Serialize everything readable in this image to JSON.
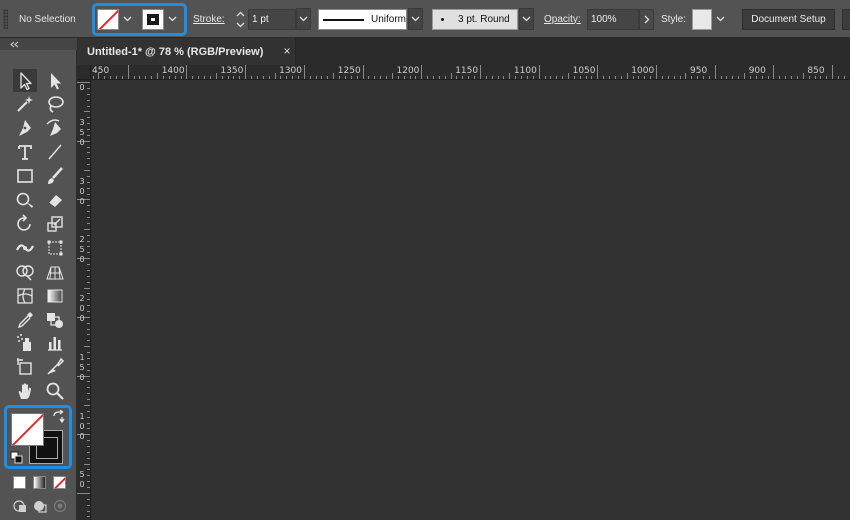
{
  "control_bar": {
    "selection_label": "No Selection",
    "fill_swatch": "none",
    "stroke_swatch": "black",
    "stroke_label": "Stroke:",
    "stroke_weight": "1 pt",
    "variable_width_profile": "Uniform",
    "brush_definition": "3 pt. Round",
    "opacity_label": "Opacity:",
    "opacity_value": "100%",
    "style_label": "Style:",
    "document_setup_label": "Document Setup"
  },
  "document": {
    "tab_title": "Untitled-1* @ 78 % (RGB/Preview)",
    "close_glyph": "×"
  },
  "rulers": {
    "horizontal_labels": [
      "450",
      "1400",
      "1350",
      "1300",
      "1250",
      "1200",
      "1150",
      "1100",
      "1050",
      "1000",
      "950",
      "900",
      "850"
    ],
    "vertical_labels": [
      {
        "digits": [
          "0"
        ]
      },
      {
        "digits": [
          "3",
          "5",
          "0"
        ]
      },
      {
        "digits": [
          "3",
          "0",
          "0"
        ]
      },
      {
        "digits": [
          "2",
          "5",
          "0"
        ]
      },
      {
        "digits": [
          "2",
          "0",
          "0"
        ]
      },
      {
        "digits": [
          "1",
          "5",
          "0"
        ]
      },
      {
        "digits": [
          "1",
          "0",
          "0"
        ]
      },
      {
        "digits": [
          "5",
          "0"
        ]
      }
    ]
  },
  "toolbar": {
    "tools": [
      "selection-tool",
      "direct-selection-tool",
      "magic-wand-tool",
      "lasso-tool",
      "pen-tool",
      "curvature-tool",
      "type-tool",
      "line-segment-tool",
      "rectangle-tool",
      "paintbrush-tool",
      "shaper-tool",
      "eraser-tool",
      "rotate-tool",
      "scale-tool",
      "width-tool",
      "free-transform-tool",
      "shape-builder-tool",
      "perspective-grid-tool",
      "mesh-tool",
      "gradient-tool",
      "eyedropper-tool",
      "blend-tool",
      "symbol-sprayer-tool",
      "column-graph-tool",
      "artboard-tool",
      "slice-tool",
      "hand-tool",
      "zoom-tool"
    ],
    "fill": "none",
    "stroke": "black"
  },
  "colors": {
    "highlight": "#1e8fe6",
    "none_slash": "#e12a2a",
    "panel": "#535353",
    "canvas": "#323232"
  }
}
